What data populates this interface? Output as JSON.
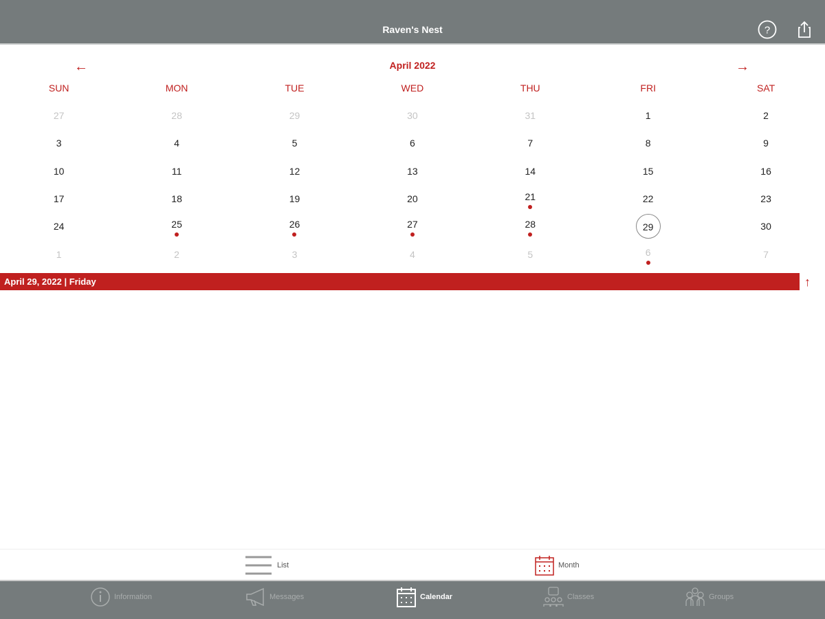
{
  "header": {
    "title": "Raven's Nest",
    "help_icon": "help-circle-icon",
    "share_icon": "share-icon"
  },
  "calendar": {
    "month_label": "April 2022",
    "weekdays": [
      "SUN",
      "MON",
      "TUE",
      "WED",
      "THU",
      "FRI",
      "SAT"
    ],
    "weeks": [
      [
        {
          "d": "27",
          "m": true
        },
        {
          "d": "28",
          "m": true
        },
        {
          "d": "29",
          "m": true
        },
        {
          "d": "30",
          "m": true
        },
        {
          "d": "31",
          "m": true
        },
        {
          "d": "1"
        },
        {
          "d": "2"
        }
      ],
      [
        {
          "d": "3"
        },
        {
          "d": "4"
        },
        {
          "d": "5"
        },
        {
          "d": "6"
        },
        {
          "d": "7"
        },
        {
          "d": "8"
        },
        {
          "d": "9"
        }
      ],
      [
        {
          "d": "10"
        },
        {
          "d": "11"
        },
        {
          "d": "12"
        },
        {
          "d": "13"
        },
        {
          "d": "14"
        },
        {
          "d": "15"
        },
        {
          "d": "16"
        }
      ],
      [
        {
          "d": "17"
        },
        {
          "d": "18"
        },
        {
          "d": "19"
        },
        {
          "d": "20"
        },
        {
          "d": "21",
          "dot": true
        },
        {
          "d": "22"
        },
        {
          "d": "23"
        }
      ],
      [
        {
          "d": "24"
        },
        {
          "d": "25",
          "dot": true
        },
        {
          "d": "26",
          "dot": true
        },
        {
          "d": "27",
          "dot": true
        },
        {
          "d": "28",
          "dot": true
        },
        {
          "d": "29",
          "today": true
        },
        {
          "d": "30"
        }
      ],
      [
        {
          "d": "1",
          "m": true
        },
        {
          "d": "2",
          "m": true
        },
        {
          "d": "3",
          "m": true
        },
        {
          "d": "4",
          "m": true
        },
        {
          "d": "5",
          "m": true
        },
        {
          "d": "6",
          "m": true,
          "dot": true
        },
        {
          "d": "7",
          "m": true
        }
      ]
    ],
    "selected_date": "April 29, 2022 | Friday"
  },
  "view_toggle": {
    "list_label": "List",
    "month_label": "Month"
  },
  "tabs": [
    {
      "label": "Information"
    },
    {
      "label": "Messages"
    },
    {
      "label": "Calendar",
      "active": true
    },
    {
      "label": "Classes"
    },
    {
      "label": "Groups"
    }
  ],
  "colors": {
    "accent": "#c0201f",
    "bar": "#757b7c"
  }
}
